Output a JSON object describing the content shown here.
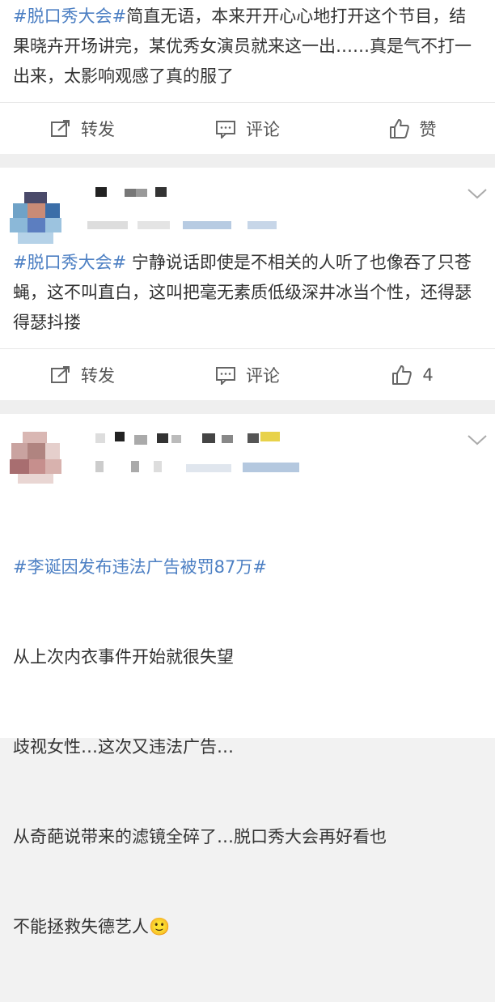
{
  "posts": [
    {
      "topic": "#脱口秀大会#",
      "text": "简直无语，本来开开心心地打开这个节目，结果晓卉开场讲完，某优秀女演员就来这一出……真是气不打一出来，太影响观感了真的服了",
      "repost_label": "转发",
      "comment_label": "评论",
      "like_label": "赞"
    },
    {
      "topic": "#脱口秀大会#",
      "text": " 宁静说话即使是不相关的人听了也像吞了只苍蝇，这不叫直白，这叫把毫无素质低级深井冰当个性，还得瑟得瑟抖搂",
      "repost_label": "转发",
      "comment_label": "评论",
      "like_count": "4"
    },
    {
      "topic": "#李诞因发布违法广告被罚87万#",
      "lines": [
        "从上次内衣事件开始就很失望",
        "歧视女性…这次又违法广告…",
        "从奇葩说带来的滤镜全碎了…脱口秀大会再好看也",
        "不能拯救失德艺人🙂"
      ]
    }
  ],
  "colors": {
    "topic": "#4c7fc3",
    "text": "#333333",
    "bg": "#f2f2f2"
  },
  "icons": [
    "repost-icon",
    "comment-icon",
    "like-icon",
    "chevron-down-icon"
  ]
}
